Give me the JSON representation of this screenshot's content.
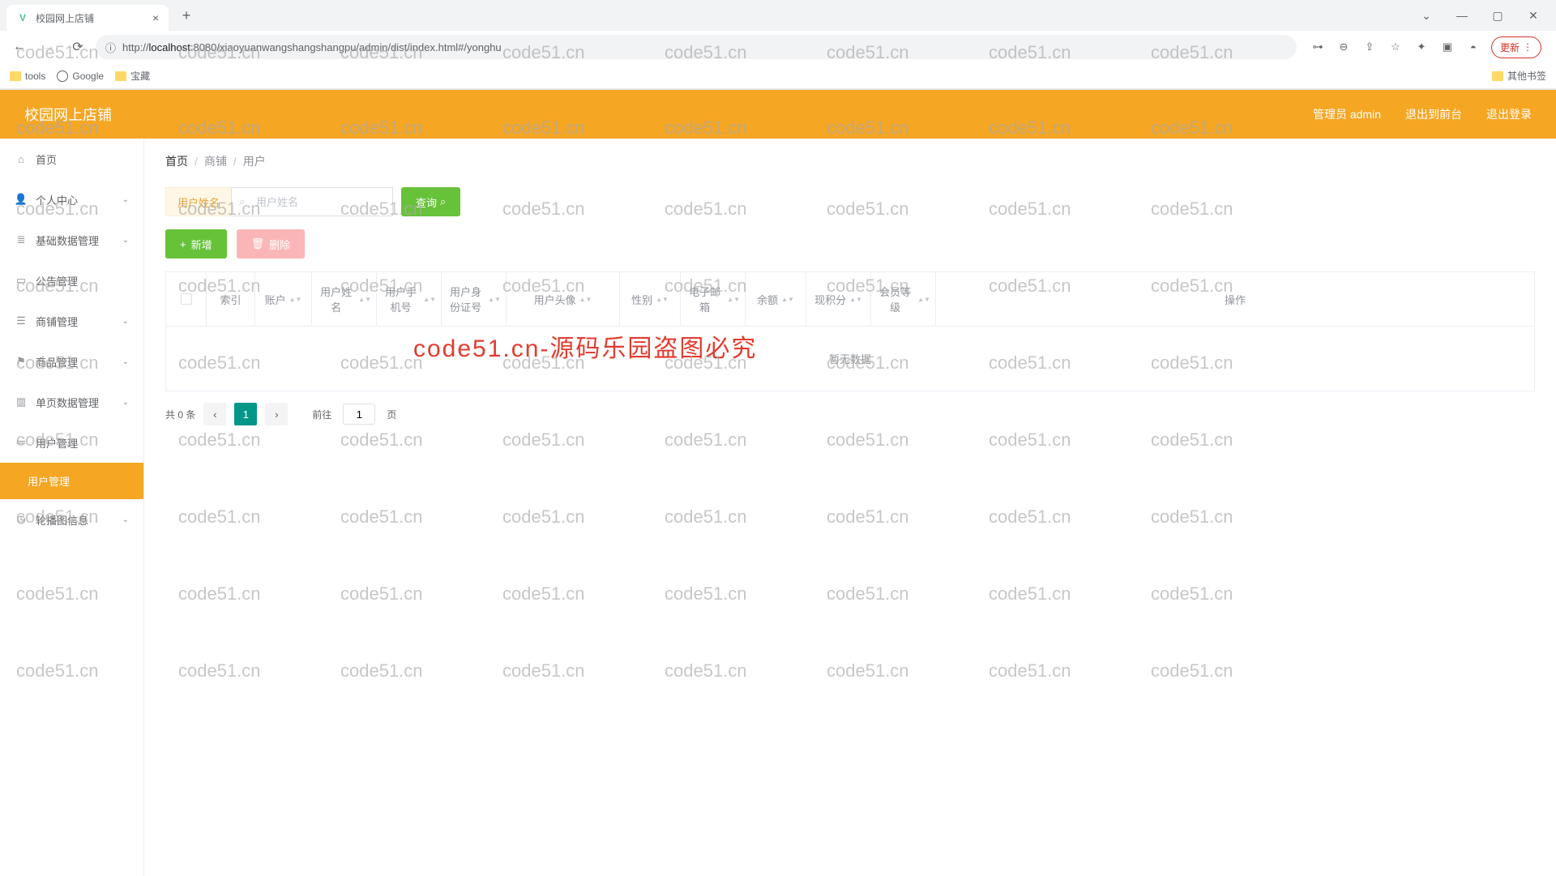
{
  "browser": {
    "tab_title": "校园网上店铺",
    "url_prefix": "http://",
    "url_host": "localhost",
    "url_port": ":8080",
    "url_path": "/xiaoyuanwangshangshangpu/admin/dist/index.html#/yonghu",
    "update_label": "更新",
    "bookmarks": {
      "tools": "tools",
      "google": "Google",
      "treasure": "宝藏",
      "other": "其他书签"
    }
  },
  "header": {
    "title": "校园网上店铺",
    "admin_label": "管理员 admin",
    "exit_front": "退出到前台",
    "logout": "退出登录"
  },
  "sidebar": {
    "home": "首页",
    "personal": "个人中心",
    "basic_data": "基础数据管理",
    "notice": "公告管理",
    "shop": "商铺管理",
    "product": "商品管理",
    "single_page": "单页数据管理",
    "user_mgmt": "用户管理",
    "user_mgmt_sub": "用户管理",
    "carousel": "轮播图信息"
  },
  "breadcrumb": {
    "home": "首页",
    "shop": "商铺",
    "user": "用户"
  },
  "filter": {
    "label": "用户姓名",
    "placeholder": "用户姓名",
    "query_btn": "查询"
  },
  "actions": {
    "add": "新增",
    "delete": "删除"
  },
  "table": {
    "headers": {
      "index": "索引",
      "account": "账户",
      "username": "用户姓名",
      "phone": "用户手机号",
      "idcard": "用户身份证号",
      "avatar": "用户头像",
      "gender": "性别",
      "email": "电子邮箱",
      "balance": "余额",
      "points": "现积分",
      "level": "会员等级",
      "operation": "操作"
    },
    "empty": "暂无数据"
  },
  "pagination": {
    "total": "共 0 条",
    "current": "1",
    "goto": "前往",
    "page_value": "1",
    "page_suffix": "页"
  },
  "watermark": {
    "text": "code51.cn",
    "red": "code51.cn-源码乐园盗图必究"
  }
}
